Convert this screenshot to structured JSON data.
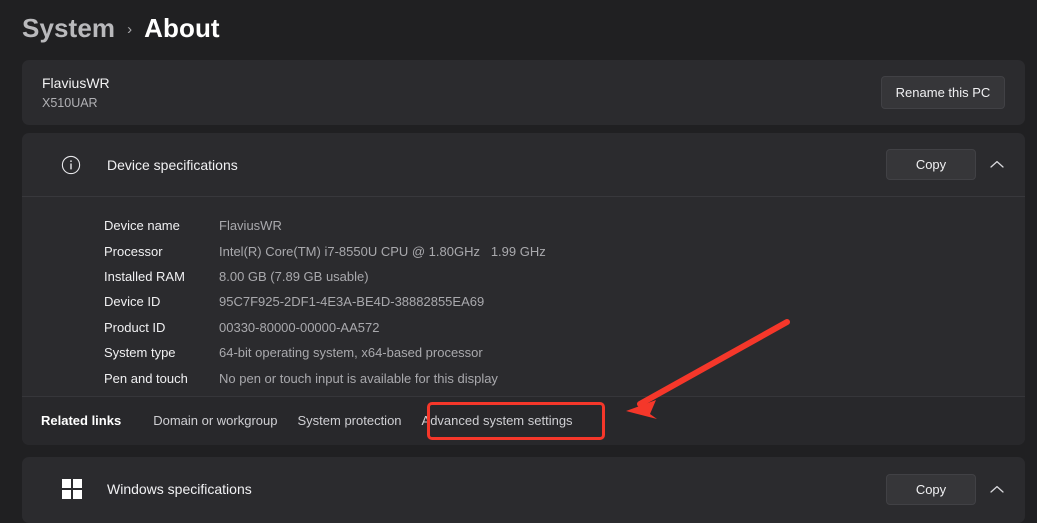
{
  "breadcrumb": {
    "parent": "System",
    "separator": "›",
    "current": "About"
  },
  "pc_card": {
    "name": "FlaviusWR",
    "model": "X510UAR",
    "rename_button": "Rename this PC"
  },
  "device_specifications": {
    "title": "Device specifications",
    "icon": "info-circle-icon",
    "copy_button": "Copy",
    "collapse_icon": "chevron-up-icon",
    "rows": [
      {
        "label": "Device name",
        "value": "FlaviusWR"
      },
      {
        "label": "Processor",
        "value": "Intel(R) Core(TM) i7-8550U CPU @ 1.80GHz   1.99 GHz"
      },
      {
        "label": "Installed RAM",
        "value": "8.00 GB (7.89 GB usable)"
      },
      {
        "label": "Device ID",
        "value": "95C7F925-2DF1-4E3A-BE4D-38882855EA69"
      },
      {
        "label": "Product ID",
        "value": "00330-80000-00000-AA572"
      },
      {
        "label": "System type",
        "value": "64-bit operating system, x64-based processor"
      },
      {
        "label": "Pen and touch",
        "value": "No pen or touch input is available for this display"
      }
    ],
    "related_links": {
      "title": "Related links",
      "links": [
        "Domain or workgroup",
        "System protection",
        "Advanced system settings"
      ]
    }
  },
  "windows_specifications": {
    "title": "Windows specifications",
    "icon": "windows-logo-icon",
    "copy_button": "Copy",
    "collapse_icon": "chevron-up-icon"
  },
  "annotations": {
    "highlight_color": "#f5372a",
    "highlight_target": "Advanced system settings",
    "arrow": "red-arrow-pointing-to-advanced-system-settings"
  }
}
